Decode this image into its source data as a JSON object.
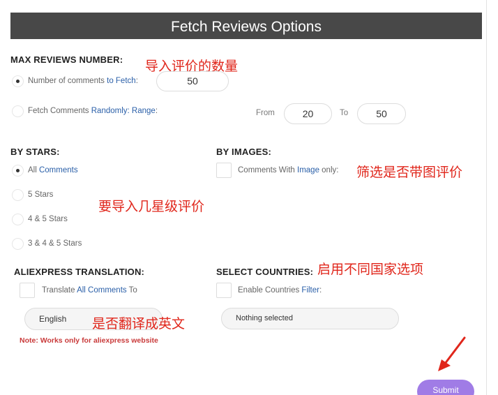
{
  "header": {
    "title": "Fetch Reviews Options"
  },
  "max_reviews": {
    "label": "MAX REVIEWS NUMBER:",
    "option_fixed": {
      "text": "Number of comments ",
      "highlight": "to Fetch",
      "suffix": ":",
      "value": "50",
      "checked": true
    },
    "option_random": {
      "text": "Fetch Comments ",
      "highlight": "Randomly: Range",
      "suffix": ":",
      "from_label": "From",
      "from_value": "20",
      "to_label": "To",
      "to_value": "50",
      "checked": false
    }
  },
  "by_stars": {
    "label": "BY STARS:",
    "options": [
      {
        "text": "All ",
        "highlight": "Comments",
        "checked": true
      },
      {
        "text": "5 Stars",
        "highlight": "",
        "checked": false
      },
      {
        "text": "4 & 5 Stars",
        "highlight": "",
        "checked": false
      },
      {
        "text": "3 & 4 & 5 Stars",
        "highlight": "",
        "checked": false
      }
    ]
  },
  "by_images": {
    "label": "BY IMAGES:",
    "checkbox_text": "Comments With ",
    "checkbox_highlight": "Image",
    "checkbox_suffix": " only:",
    "checked": false
  },
  "translation": {
    "label": "ALIEXPRESS TRANSLATION:",
    "checkbox_text": "Translate ",
    "checkbox_highlight": "All Comments",
    "checkbox_suffix": " To",
    "checked": false,
    "language_value": "English",
    "note": "Note: Works only for aliexpress website"
  },
  "countries": {
    "label": "SELECT COUNTRIES:",
    "checkbox_text": "Enable Countries ",
    "checkbox_highlight": "Filter",
    "checkbox_suffix": ":",
    "checked": false,
    "select_value": "Nothing selected"
  },
  "annotations": {
    "max_reviews": "导入评价的数量",
    "stars": "要导入几星级评价",
    "images": "筛选是否带图评价",
    "countries": "启用不同国家选项",
    "translation": "是否翻译成英文"
  },
  "submit_label": "Submit",
  "colors": {
    "header_bg": "#484848",
    "link": "#2a5fa8",
    "annotation": "#e0261b",
    "submit": "#a07ce6",
    "note": "#c93a3a"
  }
}
